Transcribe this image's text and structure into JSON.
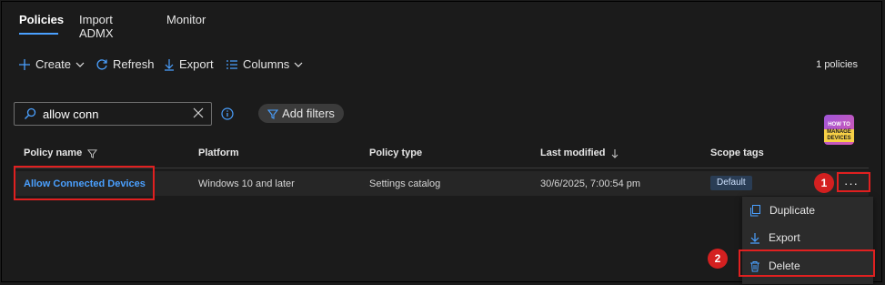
{
  "tabs": [
    {
      "label": "Policies",
      "active": true
    },
    {
      "label": "Import ADMX",
      "active": false
    },
    {
      "label": "Monitor",
      "active": false
    }
  ],
  "toolbar": {
    "create_label": "Create",
    "refresh_label": "Refresh",
    "export_label": "Export",
    "columns_label": "Columns",
    "policy_count": "1 policies"
  },
  "search": {
    "value": "allow conn"
  },
  "filters": {
    "add_label": "Add filters"
  },
  "table": {
    "columns": [
      "Policy name",
      "Platform",
      "Policy type",
      "Last modified",
      "Scope tags"
    ],
    "rows": [
      {
        "name": "Allow Connected Devices",
        "platform": "Windows 10 and later",
        "type": "Settings catalog",
        "modified": "30/6/2025, 7:00:54 pm",
        "scope": "Default"
      }
    ]
  },
  "context_menu": {
    "more_label": "···",
    "items": [
      "Duplicate",
      "Export",
      "Delete"
    ]
  },
  "steps": [
    "1",
    "2"
  ],
  "logo": {
    "line1": "HOW TO",
    "line2": "MANAGE DEVICES"
  },
  "colors": {
    "accent": "#4aa0ff",
    "highlight": "#e02020"
  }
}
